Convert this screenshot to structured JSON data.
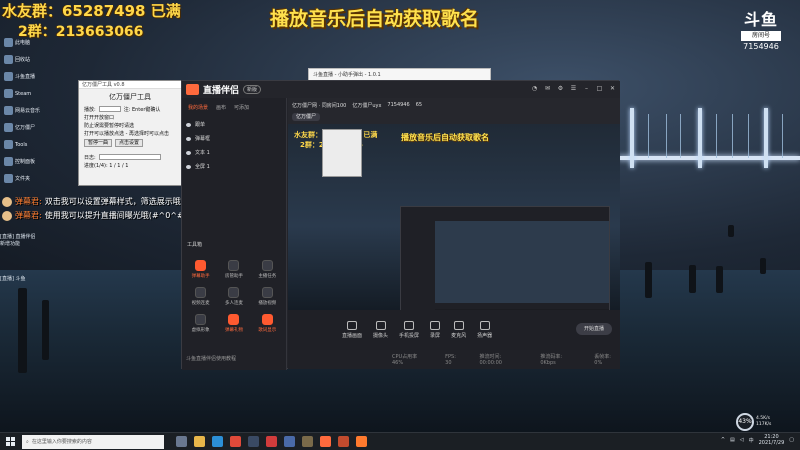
{
  "overlay": {
    "qq_line": "水友群：65287498 已满",
    "group2": "2群：213663066",
    "title": "播放音乐后自动获取歌名",
    "logo_text": "斗鱼",
    "logo_room_label": "房间号",
    "room_id": "7154946"
  },
  "danmu": [
    {
      "name": "弹幕君:",
      "text": "双击我可以设置弹幕样式，筛选展示哦~"
    },
    {
      "name": "弹幕君:",
      "text": "使用我可以提升直播间曝光哦(#^0^#)"
    }
  ],
  "tool_window": {
    "titlebar": "亿万僵尸工具 v0.8",
    "title": "亿万僵尸工具",
    "delay_label": "播放:",
    "hotkey_label": "注: Enter键确认",
    "opt1": "打开开放窗口",
    "opt2": "防止误需要暂停时请选",
    "opt3": "打开可以播放点选 - 再选择时可以点击",
    "btn_prev": "暂停一曲",
    "btn_open": "点击设置",
    "log_label": "日志:",
    "progress": "进度(1/4): 1 / 1 / 1"
  },
  "mini_window": {
    "title": "斗鱼直播 - 小助手弹出 - 1.0.1"
  },
  "app": {
    "name": "直播伴侣",
    "version_pill": "新版",
    "tabs": [
      "我的场景",
      "画布",
      "可添加"
    ],
    "layers": [
      "跟单",
      "弹幕框",
      "文本 1",
      "全屏 1"
    ],
    "tools_label": "工具箱",
    "tools": [
      {
        "label": "弹幕助手",
        "hot": true
      },
      {
        "label": "房管助手",
        "hot": false
      },
      {
        "label": "主播任务",
        "hot": false
      },
      {
        "label": "视频连麦",
        "hot": false
      },
      {
        "label": "多人连麦",
        "hot": false
      },
      {
        "label": "播放视频",
        "hot": false
      },
      {
        "label": "虚拟形象",
        "hot": false
      },
      {
        "label": "弹幕礼物",
        "hot": true
      },
      {
        "label": "歌词显示",
        "hot": true
      }
    ],
    "left_footer": "斗鱼直播伴侣使用教程",
    "strip_room": "亿万僵尸网 · 同房间100",
    "strip_user": "亿万僵尸uyx",
    "strip_id": "7154946",
    "strip_hot": "65",
    "strip_chip": "亿万僵尸",
    "controls": [
      "直播画面",
      "摄像头",
      "手机投屏",
      "录屏",
      "麦克风",
      "扬声器"
    ],
    "go_live": "开始直播",
    "status": [
      "CPU占用率 46%",
      "FPS: 30",
      "推流时间: 00:00:00",
      "推流码率: 0Kbps",
      "丢帧率: 0%"
    ],
    "nested_qq": "水友群：65287498 已满",
    "nested_group": "2群：213663066",
    "nested_title": "播放音乐后自动获取歌名"
  },
  "desktop_icons": [
    "此电脑",
    "回收站",
    "斗鱼直播",
    "Steam",
    "网易云音乐",
    "亿万僵尸",
    "Tools",
    "控制面板",
    "文件夹",
    "截图工具"
  ],
  "side_labels": [
    "[直播] 直播伴侣 新增功能",
    "[直播] 斗鱼"
  ],
  "net": {
    "percent": "43%",
    "up": "4.5K/s",
    "down": "117K/s"
  },
  "taskbar": {
    "search_placeholder": "在这里输入你要搜索的内容",
    "time": "21:20",
    "date": "2021/7/29"
  },
  "colors": {
    "accent": "#ff6a3d",
    "overlay_yellow": "#ffd84a"
  }
}
